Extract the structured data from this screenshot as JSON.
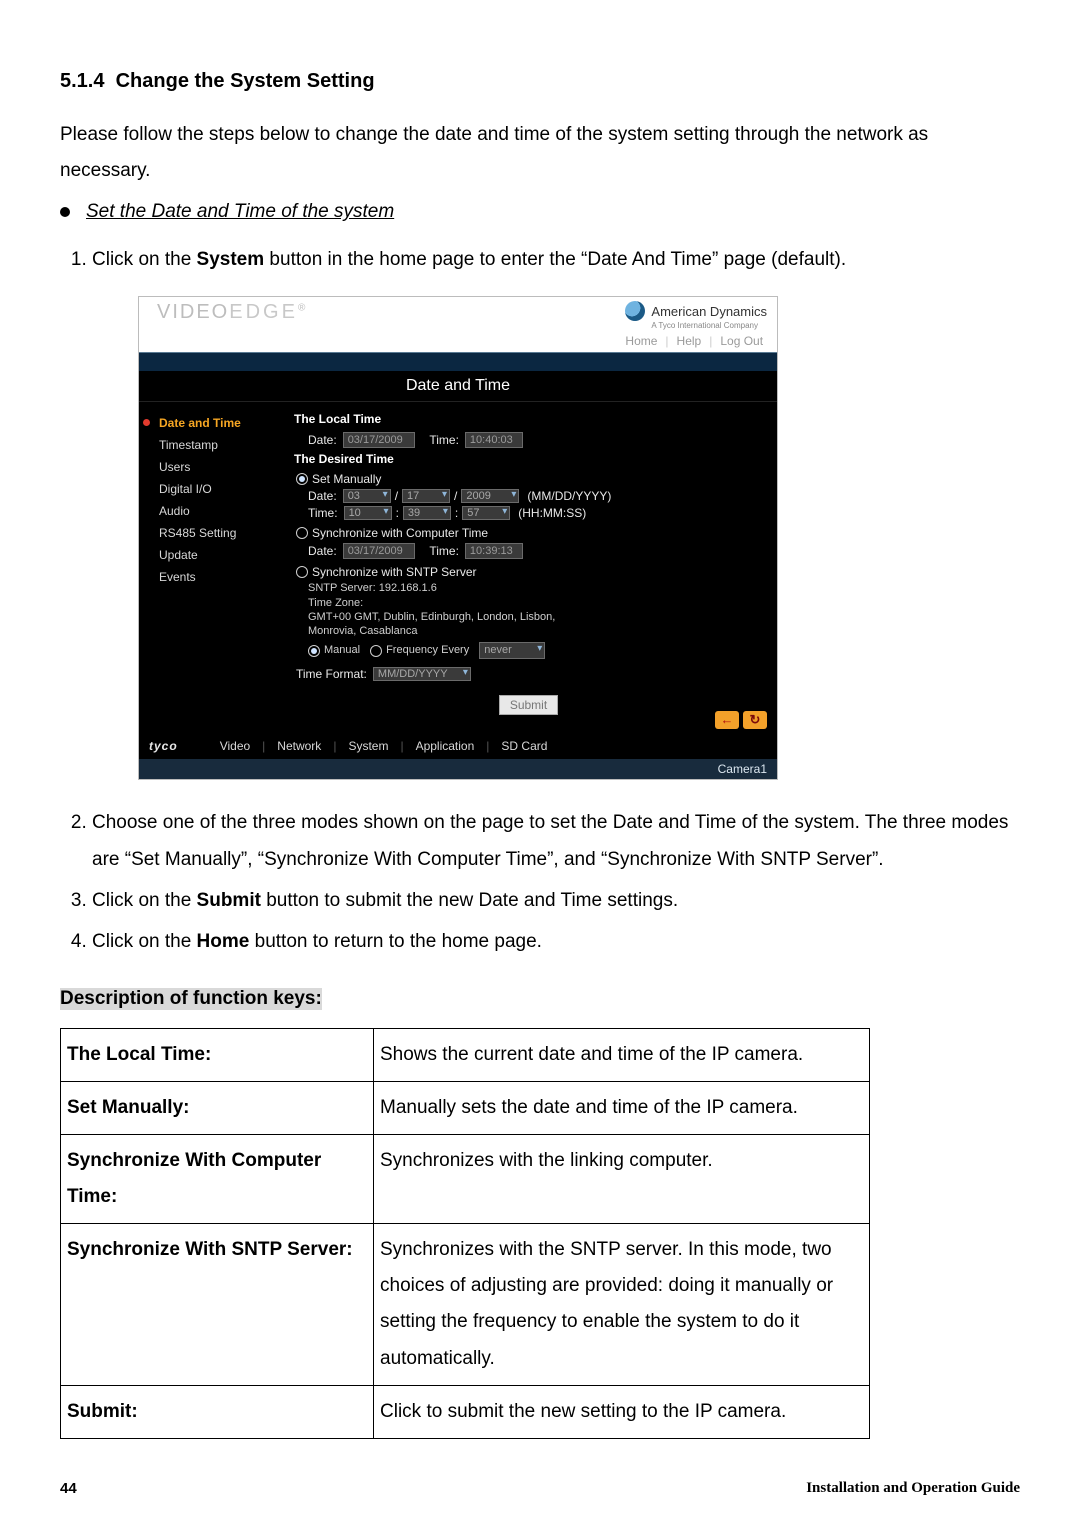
{
  "doc": {
    "section_number": "5.1.4",
    "section_title": "Change the System Setting",
    "intro": "Please follow the steps below to change the date and time of the system setting through the network as necessary.",
    "bullet_heading": "Set the Date and Time of the system",
    "step1_pre": "Click on the ",
    "step1_bold": "System",
    "step1_post": " button in the home page to enter the “Date And Time” page (default).",
    "step2": "Choose one of the three modes shown on the page to set the Date and Time of the system. The three modes are “Set Manually”, “Synchronize With Computer Time”, and “Synchronize With SNTP Server”.",
    "step3_pre": "Click on the ",
    "step3_bold": "Submit",
    "step3_post": " button to submit the new Date and Time settings.",
    "step4_pre": "Click on the ",
    "step4_bold": "Home",
    "step4_post": " button to return to the home page.",
    "fk_heading": "Description of function keys:",
    "page_number": "44",
    "footer_guide": "Installation and Operation Guide"
  },
  "shot": {
    "logo_a": "Video",
    "logo_b": "Edge",
    "brand": "American Dynamics",
    "brand_sub": "A Tyco International Company",
    "top_links": {
      "home": "Home",
      "help": "Help",
      "logout": "Log Out"
    },
    "page_title": "Date and Time",
    "sidebar": {
      "items": [
        {
          "label": "Date and Time",
          "active": true
        },
        {
          "label": "Timestamp"
        },
        {
          "label": "Users"
        },
        {
          "label": "Digital I/O"
        },
        {
          "label": "Audio"
        },
        {
          "label": "RS485 Setting"
        },
        {
          "label": "Update"
        },
        {
          "label": "Events"
        }
      ]
    },
    "local": {
      "heading": "The Local Time",
      "date_label": "Date:",
      "date_value": "03/17/2009",
      "time_label": "Time:",
      "time_value": "10:40:03"
    },
    "desired": {
      "heading": "The Desired Time",
      "set_manually": "Set Manually",
      "date_label": "Date:",
      "mm": "03",
      "dd": "17",
      "yyyy": "2009",
      "date_hint": "(MM/DD/YYYY)",
      "time_label": "Time:",
      "hh": "10",
      "min": "39",
      "ss": "57",
      "time_hint": "(HH:MM:SS)",
      "sync_comp": "Synchronize with Computer Time",
      "comp_date_label": "Date:",
      "comp_date": "03/17/2009",
      "comp_time_label": "Time:",
      "comp_time": "10:39:13",
      "sync_sntp": "Synchronize with SNTP Server",
      "sntp_label": "SNTP Server:",
      "sntp_value": "192.168.1.6",
      "tz_label": "Time Zone:",
      "tz_value": "GMT+00 GMT, Dublin, Edinburgh, London, Lisbon, Monrovia, Casablanca",
      "mode_manual": "Manual",
      "mode_freq": "Frequency Every",
      "freq_value": "never",
      "time_format_label": "Time Format:",
      "time_format_value": "MM/DD/YYYY"
    },
    "submit": "Submit",
    "bottom": {
      "tyco": "tyco",
      "tabs": {
        "video": "Video",
        "network": "Network",
        "system": "System",
        "application": "Application",
        "sdcard": "SD Card"
      },
      "back": "←",
      "refresh": "↻",
      "camera": "Camera1"
    }
  },
  "fk": {
    "rows": [
      {
        "key": "The Local Time:",
        "val": "Shows the current date and time of the IP camera."
      },
      {
        "key": "Set Manually:",
        "val": "Manually sets the date and time of the IP camera."
      },
      {
        "key": "Synchronize With Computer Time:",
        "val": "Synchronizes with the linking computer."
      },
      {
        "key": "Synchronize With SNTP Server:",
        "val": "Synchronizes with the SNTP server. In this mode, two choices of adjusting are provided: doing it manually or setting the frequency to enable the system to do it automatically."
      },
      {
        "key": "Submit:",
        "val": "Click to submit the new setting to the IP camera."
      }
    ]
  }
}
